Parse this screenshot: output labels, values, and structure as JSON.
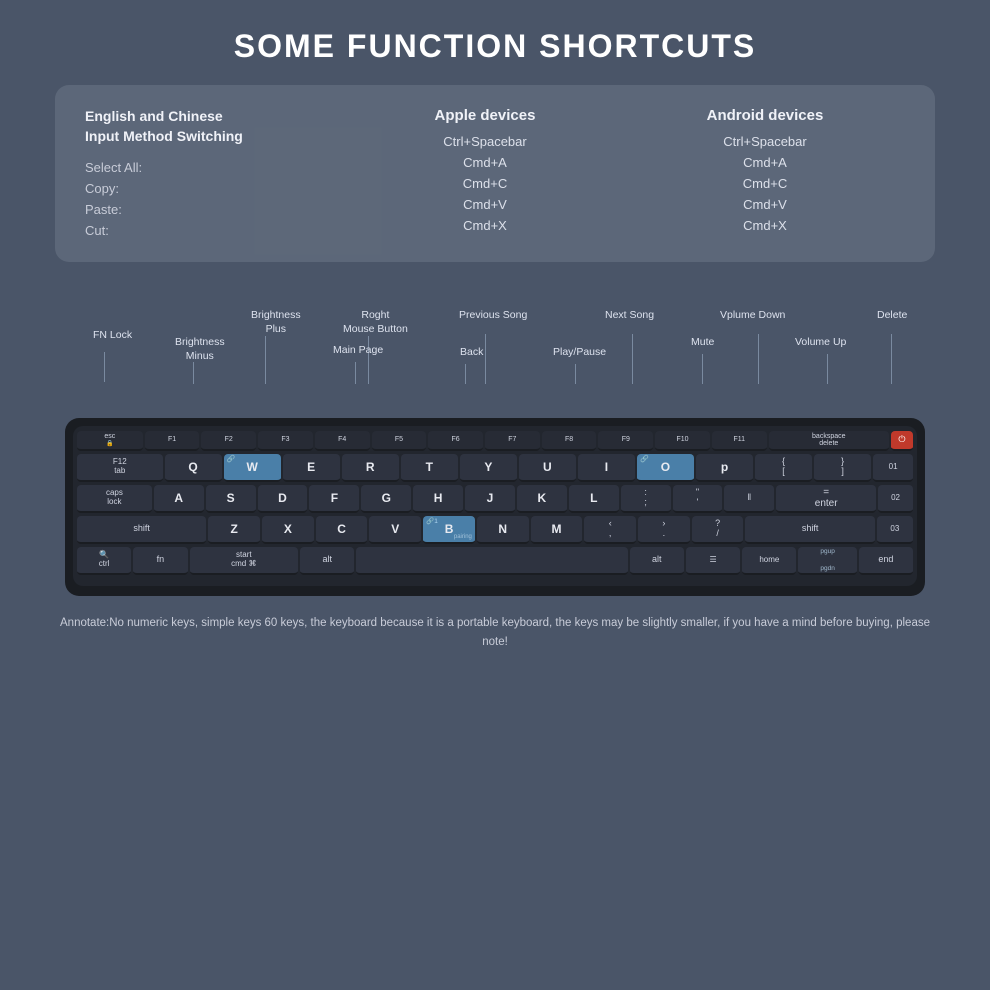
{
  "title": "SOME FUNCTION SHORTCUTS",
  "table": {
    "col1_header": "English and Chinese\nInput Method Switching",
    "col2_header": "Apple devices",
    "col3_header": "Android devices",
    "rows": [
      {
        "label": "",
        "apple": "Ctrl+Spacebar",
        "android": "Ctrl+Spacebar"
      },
      {
        "label": "Select All:",
        "apple": "Cmd+A",
        "android": "Cmd+A"
      },
      {
        "label": "Copy:",
        "apple": "Cmd+C",
        "android": "Cmd+C"
      },
      {
        "label": "Paste:",
        "apple": "Cmd+V",
        "android": "Cmd+V"
      },
      {
        "label": "Cut:",
        "apple": "Cmd+X",
        "android": "Cmd+X"
      }
    ]
  },
  "labels": {
    "fn_lock": "FN Lock",
    "brightness_plus": "Brightness\nPlus",
    "brightness_minus": "Brightness\nMinus",
    "right_mouse": "Roght\nMouse Button",
    "main_page": "Main Page",
    "previous_song": "Previous Song",
    "back": "Back",
    "next_song": "Next Song",
    "play_pause": "Play/Pause",
    "mute": "Mute",
    "volume_down": "Vplume Down",
    "volume_up": "Volume Up",
    "delete": "Delete"
  },
  "annotate": "Annotate:No numeric keys, simple keys 60 keys, the keyboard because it is a portable keyboard, the keys may be slightly smaller, if you have a mind before buying, please note!"
}
